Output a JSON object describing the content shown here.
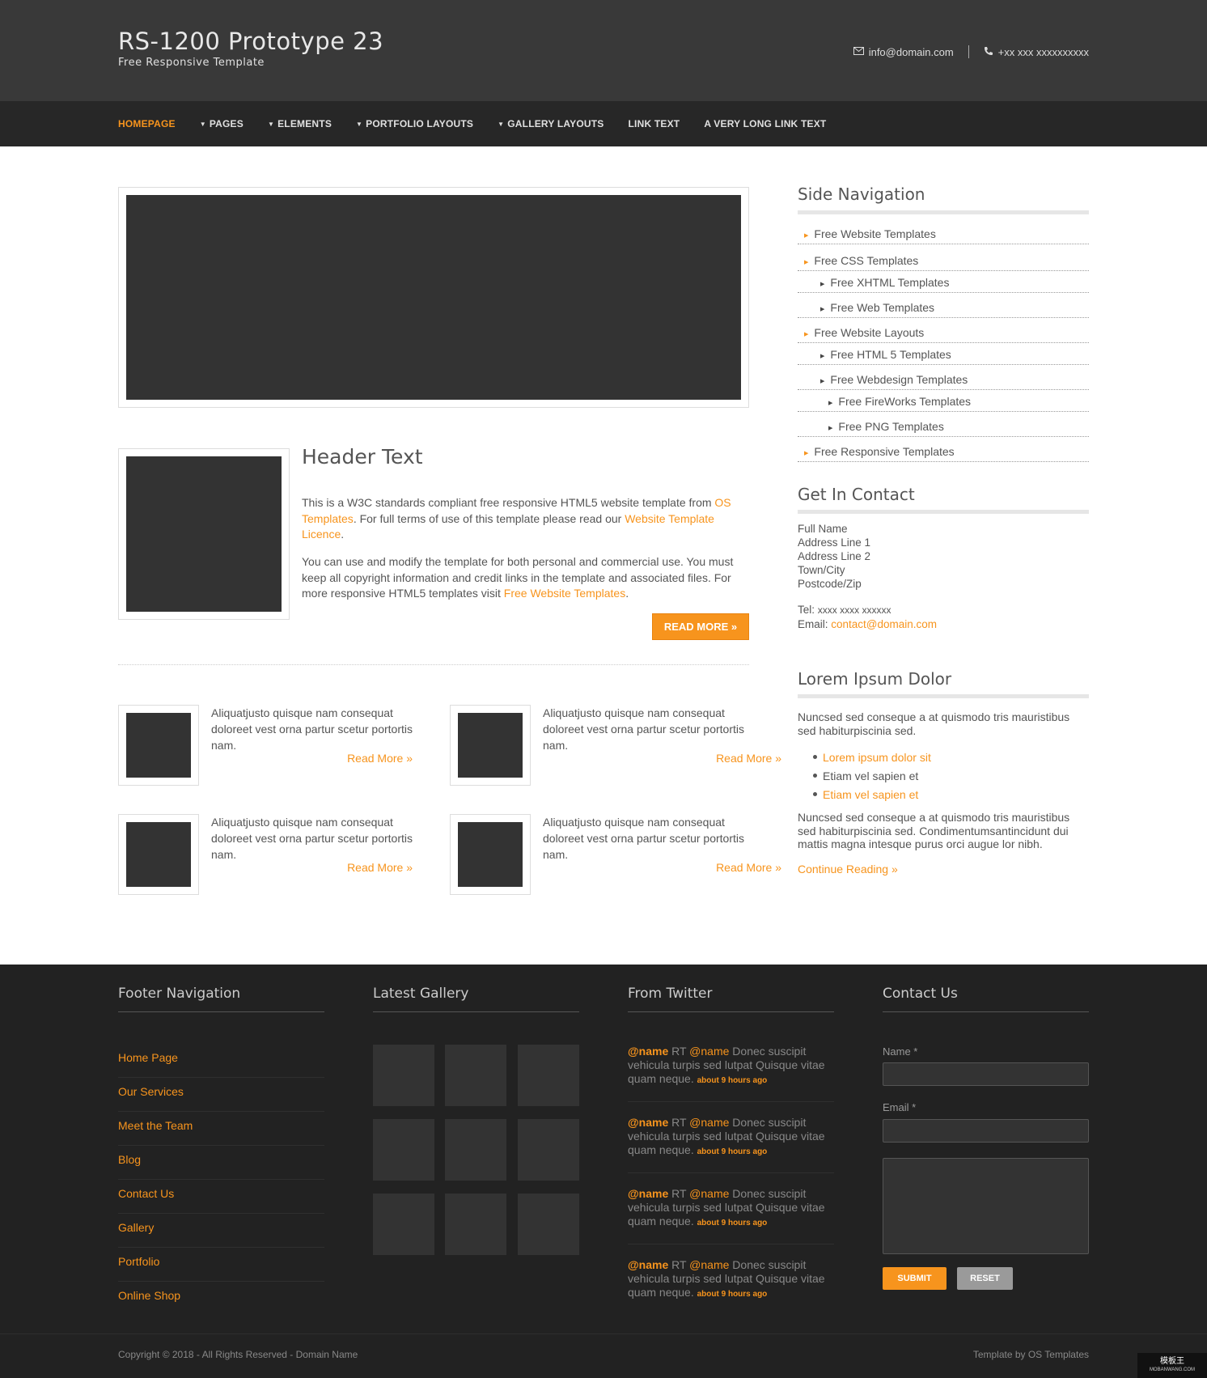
{
  "header": {
    "title": "RS-1200 Prototype 23",
    "subtitle": "Free Responsive Template",
    "email": "info@domain.com",
    "phone": "+xx xxx xxxxxxxxxx"
  },
  "nav": {
    "items": [
      {
        "label": "HOMEPAGE",
        "active": true,
        "dropdown": false
      },
      {
        "label": "PAGES",
        "active": false,
        "dropdown": true
      },
      {
        "label": "ELEMENTS",
        "active": false,
        "dropdown": true
      },
      {
        "label": "PORTFOLIO LAYOUTS",
        "active": false,
        "dropdown": true
      },
      {
        "label": "GALLERY LAYOUTS",
        "active": false,
        "dropdown": true
      },
      {
        "label": "LINK TEXT",
        "active": false,
        "dropdown": false
      },
      {
        "label": "A VERY LONG LINK TEXT",
        "active": false,
        "dropdown": false
      }
    ]
  },
  "featured": {
    "title": "Header Text",
    "p1_a": "This is a W3C standards compliant free responsive HTML5 website template from ",
    "p1_link1": "OS Templates",
    "p1_b": ". For full terms of use of this template please read our ",
    "p1_link2": "Website Template Licence",
    "p1_c": ".",
    "p2_a": "You can use and modify the template for both personal and commercial use. You must keep all copyright information and credit links in the template and associated files. For more responsive HTML5 templates visit ",
    "p2_link": "Free Website Templates",
    "p2_b": ".",
    "read_more": "READ MORE »"
  },
  "minis": [
    {
      "text": "Aliquatjusto quisque nam consequat doloreet vest orna partur scetur portortis nam.",
      "link": "Read More »"
    },
    {
      "text": "Aliquatjusto quisque nam consequat doloreet vest orna partur scetur portortis nam.",
      "link": "Read More »"
    },
    {
      "text": "Aliquatjusto quisque nam consequat doloreet vest orna partur scetur portortis nam.",
      "link": "Read More »"
    },
    {
      "text": "Aliquatjusto quisque nam consequat doloreet vest orna partur scetur portortis nam.",
      "link": "Read More »"
    }
  ],
  "sidebar": {
    "nav_title": "Side Navigation",
    "nav_items": [
      {
        "label": "Free Website Templates",
        "level": 1
      },
      {
        "label": "Free CSS Templates",
        "level": 1
      },
      {
        "label": "Free XHTML Templates",
        "level": 2
      },
      {
        "label": "Free Web Templates",
        "level": 2
      },
      {
        "label": "Free Website Layouts",
        "level": 1
      },
      {
        "label": "Free HTML 5 Templates",
        "level": 2
      },
      {
        "label": "Free Webdesign Templates",
        "level": 2
      },
      {
        "label": "Free FireWorks Templates",
        "level": 3
      },
      {
        "label": "Free PNG Templates",
        "level": 3
      },
      {
        "label": "Free Responsive Templates",
        "level": 1
      }
    ],
    "contact_title": "Get In Contact",
    "contact": {
      "name": "Full Name",
      "addr1": "Address Line 1",
      "addr2": "Address Line 2",
      "town": "Town/City",
      "postcode": "Postcode/Zip",
      "tel_label": "Tel:",
      "tel": "xxxx xxxx xxxxxx",
      "email_label": "Email:",
      "email": "contact@domain.com"
    },
    "lorem_title": "Lorem Ipsum Dolor",
    "lorem_p1": "Nuncsed sed conseque a at quismodo tris mauristibus sed habiturpiscinia sed.",
    "lorem_list": [
      {
        "label": "Lorem ipsum dolor sit",
        "link": true
      },
      {
        "label": "Etiam vel sapien et",
        "link": false
      },
      {
        "label": "Etiam vel sapien et",
        "link": true
      }
    ],
    "lorem_p2": "Nuncsed sed conseque a at quismodo tris mauristibus sed habiturpiscinia sed. Condimentumsantincidunt dui mattis magna intesque purus orci augue lor nibh.",
    "continue": "Continue Reading »"
  },
  "footer": {
    "nav_title": "Footer Navigation",
    "nav_items": [
      "Home Page",
      "Our Services",
      "Meet the Team",
      "Blog",
      "Contact Us",
      "Gallery",
      "Portfolio",
      "Online Shop"
    ],
    "gallery_title": "Latest Gallery",
    "twitter_title": "From Twitter",
    "tweets": [
      {
        "handle": "@name",
        "rt": " RT ",
        "mention": "@name",
        "text": " Donec suscipit vehicula turpis sed lutpat Quisque vitae quam neque. ",
        "ago": "about 9 hours ago"
      },
      {
        "handle": "@name",
        "rt": " RT ",
        "mention": "@name",
        "text": " Donec suscipit vehicula turpis sed lutpat Quisque vitae quam neque. ",
        "ago": "about 9 hours ago"
      },
      {
        "handle": "@name",
        "rt": " RT ",
        "mention": "@name",
        "text": " Donec suscipit vehicula turpis sed lutpat Quisque vitae quam neque. ",
        "ago": "about 9 hours ago"
      },
      {
        "handle": "@name",
        "rt": " RT ",
        "mention": "@name",
        "text": " Donec suscipit vehicula turpis sed lutpat Quisque vitae quam neque. ",
        "ago": "about 9 hours ago"
      }
    ],
    "contact_title": "Contact Us",
    "name_label": "Name *",
    "email_label": "Email *",
    "submit": "SUBMIT",
    "reset": "RESET",
    "copyright": "Copyright © 2018 - All Rights Reserved - Domain Name",
    "credit": "Template by OS Templates"
  },
  "watermark": {
    "main": "模板王",
    "sub": "MOBANWANG.COM"
  },
  "colors": {
    "accent": "#f7941d",
    "header_bg": "#393939",
    "nav_bg": "#272727",
    "footer_bg": "#222222",
    "placeholder": "#333333"
  }
}
